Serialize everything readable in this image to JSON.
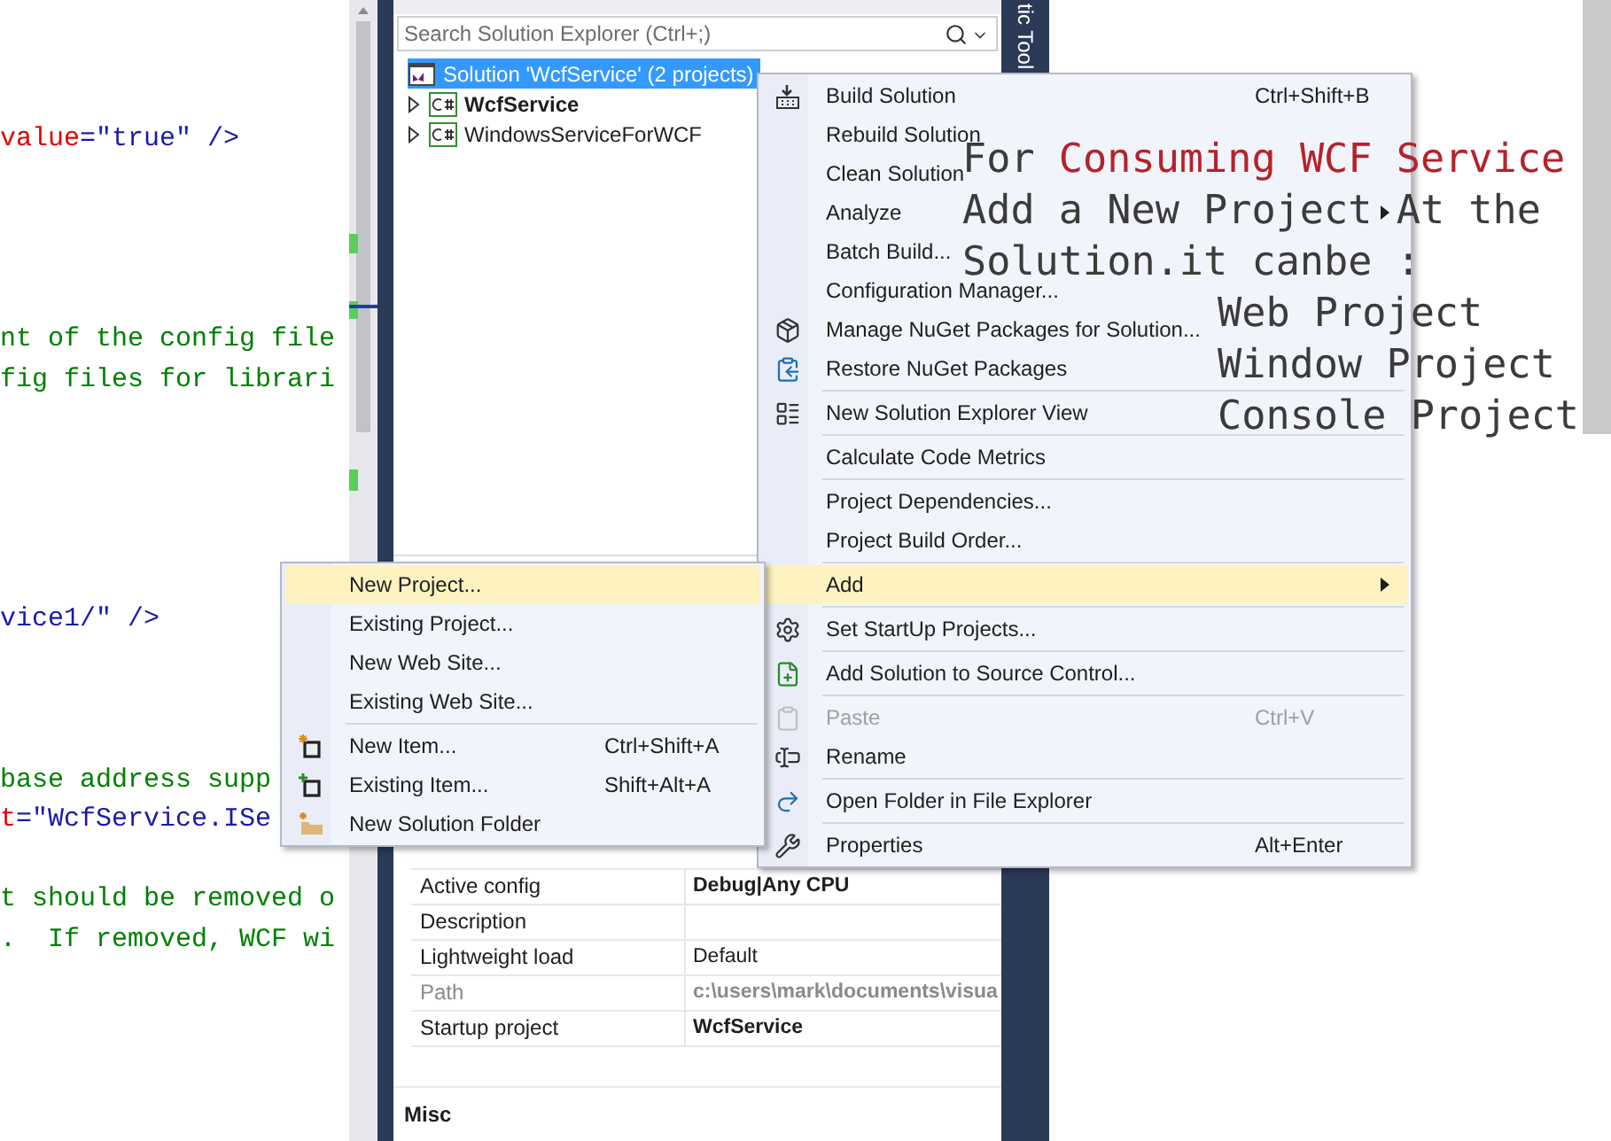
{
  "editor": {
    "lines": [
      {
        "segments": [
          {
            "text": "value",
            "kind": "attribute"
          },
          {
            "text": "=\"true\" />",
            "kind": "value"
          }
        ]
      },
      {
        "segments": [
          {
            "text": "nt of the config file",
            "kind": "comment"
          }
        ]
      },
      {
        "segments": [
          {
            "text": "fig files for librari",
            "kind": "comment"
          }
        ]
      },
      {
        "segments": [
          {
            "text": "vice1/\" />",
            "kind": "value"
          }
        ]
      },
      {
        "segments": [
          {
            "text": "base address supp",
            "kind": "comment"
          }
        ]
      },
      {
        "segments": [
          {
            "text": "t",
            "kind": "attribute"
          },
          {
            "text": "=\"WcfService.ISe",
            "kind": "value"
          }
        ]
      },
      {
        "segments": [
          {
            "text": "t should be removed o",
            "kind": "comment"
          }
        ]
      },
      {
        "segments": [
          {
            "text": ".  If removed, WCF wi",
            "kind": "comment"
          }
        ]
      }
    ]
  },
  "solution_explorer": {
    "search": {
      "placeholder": "Search Solution Explorer (Ctrl+;)"
    },
    "tree": [
      {
        "label": "Solution 'WcfService' (2 projects)",
        "kind": "solution",
        "selected": true,
        "bold": false,
        "children": [
          {
            "label": "WcfService",
            "kind": "project",
            "selected": false,
            "bold": true,
            "expanded": false
          },
          {
            "label": "WindowsServiceForWCF",
            "kind": "project",
            "selected": false,
            "bold": false,
            "expanded": false
          }
        ]
      }
    ]
  },
  "properties": {
    "rows": [
      {
        "name": "Active config",
        "value": "Debug|Any CPU",
        "bold": true,
        "disabled": false
      },
      {
        "name": "Description",
        "disabled": false
      },
      {
        "name": "Lightweight load",
        "value": "Default",
        "bold": false,
        "disabled": false
      },
      {
        "name": "Path",
        "value": "c:\\users\\mark\\documents\\visua",
        "bold": true,
        "disabled": true
      },
      {
        "name": "Startup project",
        "value": "WcfService",
        "bold": true,
        "disabled": false
      }
    ],
    "category": "Misc"
  },
  "side_tab": {
    "label": "tic Tool"
  },
  "context_menu": {
    "items": [
      {
        "kind": "item",
        "label": "Build Solution",
        "shortcut": "Ctrl+Shift+B",
        "selected": false,
        "disabled": false,
        "has_submenu": false
      },
      {
        "kind": "item",
        "label": "Rebuild Solution",
        "selected": false,
        "disabled": false,
        "has_submenu": false
      },
      {
        "kind": "item",
        "label": "Clean Solution",
        "selected": false,
        "disabled": false,
        "has_submenu": false
      },
      {
        "kind": "item",
        "label": "Analyze",
        "selected": false,
        "disabled": false,
        "has_submenu": true
      },
      {
        "kind": "item",
        "label": "Batch Build...",
        "selected": false,
        "disabled": false,
        "has_submenu": false
      },
      {
        "kind": "item",
        "label": "Configuration Manager...",
        "selected": false,
        "disabled": false,
        "has_submenu": false
      },
      {
        "kind": "item",
        "label": "Manage NuGet Packages for Solution...",
        "selected": false,
        "disabled": false,
        "has_submenu": false
      },
      {
        "kind": "item",
        "label": "Restore NuGet Packages",
        "selected": false,
        "disabled": false,
        "has_submenu": false
      },
      {
        "kind": "separator"
      },
      {
        "kind": "item",
        "label": "New Solution Explorer View",
        "selected": false,
        "disabled": false,
        "has_submenu": false
      },
      {
        "kind": "separator"
      },
      {
        "kind": "item",
        "label": "Calculate Code Metrics",
        "selected": false,
        "disabled": false,
        "has_submenu": false
      },
      {
        "kind": "separator"
      },
      {
        "kind": "item",
        "label": "Project Dependencies...",
        "selected": false,
        "disabled": false,
        "has_submenu": false
      },
      {
        "kind": "item",
        "label": "Project Build Order...",
        "selected": false,
        "disabled": false,
        "has_submenu": false
      },
      {
        "kind": "separator"
      },
      {
        "kind": "item",
        "label": "Add",
        "selected": true,
        "disabled": false,
        "has_submenu": true
      },
      {
        "kind": "separator"
      },
      {
        "kind": "item",
        "label": "Set StartUp Projects...",
        "selected": false,
        "disabled": false,
        "has_submenu": false
      },
      {
        "kind": "separator"
      },
      {
        "kind": "item",
        "label": "Add Solution to Source Control...",
        "selected": false,
        "disabled": false,
        "has_submenu": false
      },
      {
        "kind": "separator"
      },
      {
        "kind": "item",
        "label": "Paste",
        "shortcut": "Ctrl+V",
        "selected": false,
        "disabled": true,
        "has_submenu": false
      },
      {
        "kind": "item",
        "label": "Rename",
        "selected": false,
        "disabled": false,
        "has_submenu": false
      },
      {
        "kind": "separator"
      },
      {
        "kind": "item",
        "label": "Open Folder in File Explorer",
        "selected": false,
        "disabled": false,
        "has_submenu": false
      },
      {
        "kind": "separator"
      },
      {
        "kind": "item",
        "label": "Properties",
        "shortcut": "Alt+Enter",
        "selected": false,
        "disabled": false,
        "has_submenu": false
      }
    ]
  },
  "submenu": {
    "items": [
      {
        "kind": "item",
        "label": "New Project...",
        "selected": true,
        "disabled": false,
        "has_submenu": false
      },
      {
        "kind": "item",
        "label": "Existing Project...",
        "selected": false,
        "disabled": false,
        "has_submenu": false
      },
      {
        "kind": "item",
        "label": "New Web Site...",
        "selected": false,
        "disabled": false,
        "has_submenu": false
      },
      {
        "kind": "item",
        "label": "Existing Web Site...",
        "selected": false,
        "disabled": false,
        "has_submenu": false
      },
      {
        "kind": "separator"
      },
      {
        "kind": "item",
        "label": "New Item...",
        "shortcut": "Ctrl+Shift+A",
        "selected": false,
        "disabled": false,
        "has_submenu": false
      },
      {
        "kind": "item",
        "label": "Existing Item...",
        "shortcut": "Shift+Alt+A",
        "selected": false,
        "disabled": false,
        "has_submenu": false
      },
      {
        "kind": "item",
        "label": "New Solution Folder",
        "selected": false,
        "disabled": false,
        "has_submenu": false
      }
    ]
  },
  "annotation": {
    "lines": [
      {
        "indented": false,
        "segments": [
          {
            "text": "For ",
            "kind": "plain"
          },
          {
            "text": "Consuming WCF Service",
            "kind": "highlight"
          }
        ]
      },
      {
        "indented": false,
        "segments": [
          {
            "text": "Add a New Project At the",
            "kind": "plain"
          }
        ]
      },
      {
        "indented": false,
        "segments": [
          {
            "text": "Solution.it canbe :",
            "kind": "plain"
          }
        ]
      },
      {
        "indented": true,
        "segments": [
          {
            "text": "Web Project",
            "kind": "plain"
          }
        ]
      },
      {
        "indented": true,
        "segments": [
          {
            "text": "Window Project",
            "kind": "plain"
          }
        ]
      },
      {
        "indented": true,
        "segments": [
          {
            "text": "Console Project",
            "kind": "plain"
          }
        ]
      }
    ]
  }
}
